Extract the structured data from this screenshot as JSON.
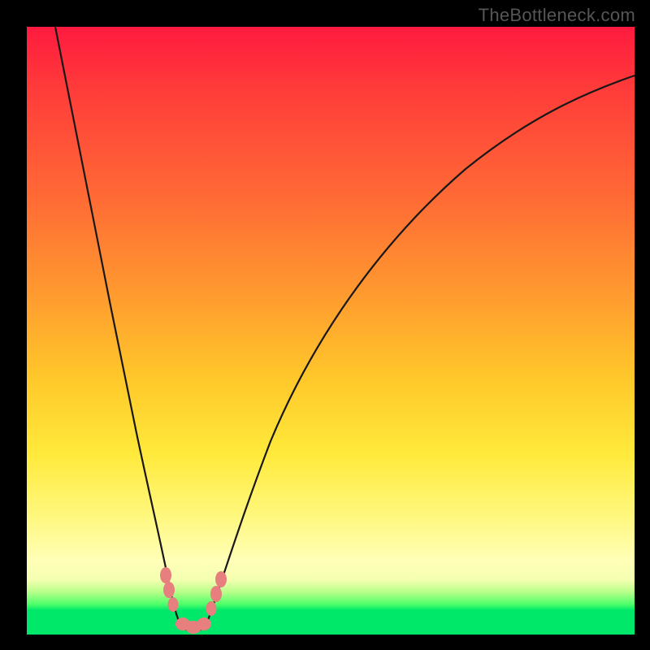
{
  "attribution": "TheBottleneck.com",
  "chart_data": {
    "type": "line",
    "title": "",
    "xlabel": "",
    "ylabel": "",
    "xlim": [
      0,
      100
    ],
    "ylim": [
      0,
      100
    ],
    "note": "Bottleneck-percentage style V-curve. Y≈100 = severe bottleneck (red), Y≈0 = balanced (green). Minimum of curve sits around x≈25.",
    "series": [
      {
        "name": "bottleneck-curve",
        "x": [
          5,
          8,
          12,
          16,
          19,
          21,
          23,
          24.5,
          25,
          25.5,
          27,
          29,
          32,
          37,
          45,
          55,
          70,
          85,
          100
        ],
        "y": [
          100,
          82,
          60,
          40,
          24,
          13,
          6,
          1.5,
          0.5,
          0.5,
          1.5,
          6,
          14,
          27,
          45,
          60,
          76,
          86,
          92
        ]
      }
    ],
    "markers": [
      {
        "name": "left-arm-dot-upper",
        "x": 21.0,
        "y": 9.0
      },
      {
        "name": "left-arm-dot-mid",
        "x": 21.6,
        "y": 7.0
      },
      {
        "name": "left-arm-dot-lower",
        "x": 22.5,
        "y": 4.0
      },
      {
        "name": "valley-floor-1",
        "x": 24.0,
        "y": 1.0
      },
      {
        "name": "valley-floor-2",
        "x": 25.0,
        "y": 0.8
      },
      {
        "name": "valley-floor-3",
        "x": 26.0,
        "y": 1.0
      },
      {
        "name": "right-arm-dot-lower",
        "x": 28.0,
        "y": 3.5
      },
      {
        "name": "right-arm-dot-mid",
        "x": 29.0,
        "y": 6.0
      },
      {
        "name": "right-arm-dot-upper",
        "x": 29.8,
        "y": 8.0
      }
    ],
    "colors": {
      "curve": "#181818",
      "markers": "#e77f7f",
      "gradient_top": "#ff1a3f",
      "gradient_bottom": "#00e86a"
    }
  }
}
